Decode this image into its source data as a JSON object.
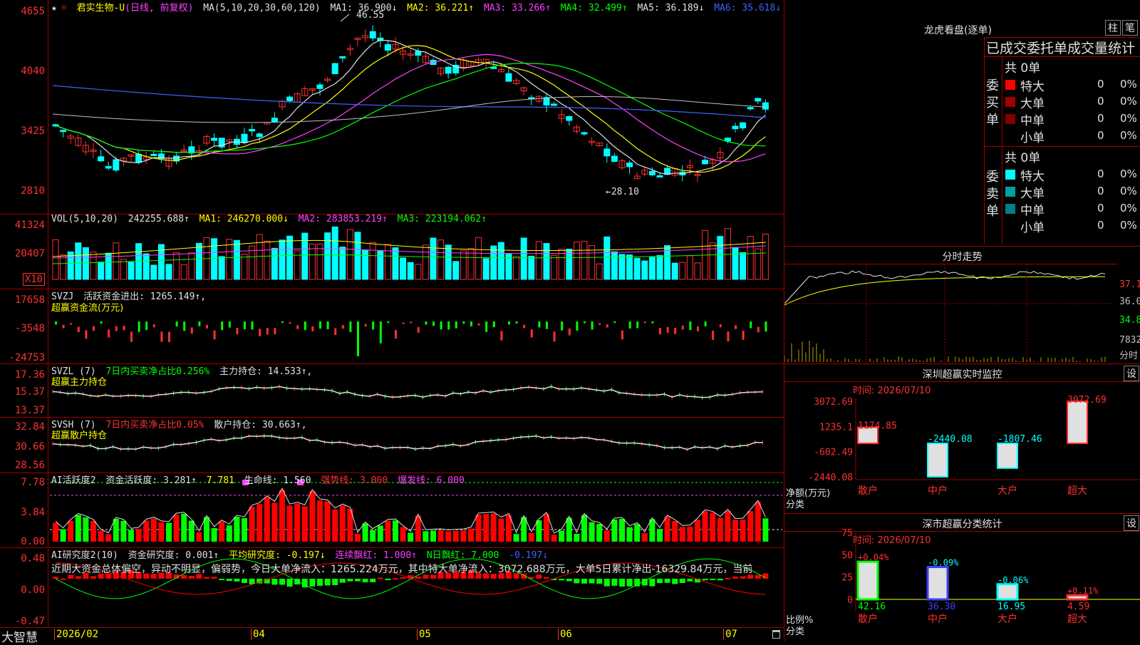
{
  "header": {
    "star": "★",
    "gear": "☼",
    "stock_name": "君实生物-U",
    "period": "(日线, 前复权)",
    "ma_params": "MA(5,10,20,30,60,120)",
    "ma1": "MA1: 36.900↓",
    "ma2": "MA2: 36.221↑",
    "ma3": "MA3: 33.266↑",
    "ma4": "MA4: 32.499↑",
    "ma5": "MA5: 36.189↓",
    "ma6": "MA6: 35.618↓",
    "high_label": "46.55",
    "low_label": "←28.10"
  },
  "price_axis": [
    "4655",
    "4040",
    "3425",
    "2810"
  ],
  "vol": {
    "header": "VOL(5,10,20)",
    "value": "242255.688↑",
    "ma1": "MA1: 246270.000↓",
    "ma2": "MA2: 283853.219↑",
    "ma3": "MA3: 223194.062↑",
    "axis": [
      "41324",
      "20407"
    ],
    "unit": "X10"
  },
  "svzj": {
    "header": "SVZJ",
    "label": "活跃资金进出: 1265.149↑,",
    "sub": "超赢资金流(万元)",
    "axis": [
      "17658",
      "-3548",
      "-24753"
    ]
  },
  "svzl": {
    "header": "SVZL (7)",
    "label1": "7日内买卖净占比0.256%",
    "label2": "主力持仓: 14.533↑,",
    "sub": "超赢主力持仓",
    "axis": [
      "17.36",
      "15.37",
      "13.37"
    ]
  },
  "svsh": {
    "header": "SVSH (7)",
    "label1": "7日内买卖净占比0.05%",
    "label2": "散户持仓: 30.663↑,",
    "sub": "超赢散户持仓",
    "axis": [
      "32.84",
      "30.66",
      "28.56"
    ]
  },
  "ai1": {
    "header": "AI活跃度2",
    "label1": "资金活跃度: 3.281↑",
    "label2": "7.781",
    "label3": "生命线: 1.560",
    "label4": "强势线: 3.000",
    "label5": "爆发线: 6.000",
    "axis": [
      "7.78",
      "3.84",
      "0.00"
    ]
  },
  "ai2": {
    "header": "AI研究度2(10)",
    "label1": "资金研究度: 0.001↑",
    "label2": "平均研究度: -0.197↓",
    "label3": "连续飘红: 1.000↑",
    "label4": "N日飘红: 7.000",
    "label5": "-0.197↓",
    "text": "近期大资金总体偏空，异动不明显，偏弱势，今日大单净流入：1265.224万元，其中特大单净流入：3072.688万元，大单5日累计净出-16329.84万元，当前",
    "axis": [
      "0.48",
      "0.00",
      "-0.47"
    ]
  },
  "bottom": {
    "brand": "大智慧",
    "dates": [
      "2026/02",
      "04",
      "05",
      "06",
      "07"
    ]
  },
  "longhu": {
    "title": "龙虎看盘(逐单)",
    "btn1": "柱",
    "btn2": "笔",
    "subtitle": "已成交委托单成交量统计",
    "buy_label": "委买单",
    "sell_label": "委卖单",
    "buy_total": "共 0单",
    "sell_total": "共 0单",
    "rows": [
      {
        "name": "特大",
        "count": "0",
        "pct": "0%"
      },
      {
        "name": "大单",
        "count": "0",
        "pct": "0%"
      },
      {
        "name": "中单",
        "count": "0",
        "pct": "0%"
      },
      {
        "name": "小单",
        "count": "0",
        "pct": "0%"
      }
    ],
    "buy_colors": [
      "#ff0000",
      "#a00000",
      "#800000",
      "#000000"
    ],
    "sell_colors": [
      "#00ffff",
      "#00a0a0",
      "#008080",
      "#000000"
    ]
  },
  "intraday": {
    "title": "分时走势",
    "axis": [
      "37.15",
      "36.00",
      "34.85",
      "7832",
      "分时"
    ]
  },
  "sz_monitor": {
    "title": "深圳超赢实时监控",
    "btn": "设",
    "time": "时间: 2026/07/10",
    "axis": [
      "3072.69",
      "1235.1",
      "-602.49",
      "-2440.08"
    ],
    "ylabel": "净额(万元)",
    "xlabel": "分类",
    "categories": [
      "散户",
      "中户",
      "大户",
      "超大"
    ],
    "value_labels": [
      "1174.85",
      "-2440.08",
      "-1807.46",
      "3072.69"
    ]
  },
  "sz_class": {
    "title": "深市超赢分类统计",
    "btn": "设",
    "time": "时间: 2026/07/10",
    "axis": [
      "75",
      "50",
      "25",
      "0"
    ],
    "ylabel": "比例%",
    "xlabel": "分类",
    "categories": [
      "散户",
      "中户",
      "大户",
      "超大"
    ],
    "top_labels": [
      "+0.04%",
      "-0.09%",
      "-0.06%",
      "+0.11%"
    ],
    "bottom_labels": [
      "42.16",
      "36.30",
      "16.95",
      "4.59"
    ]
  },
  "chart_data": [
    {
      "type": "bar",
      "title": "深圳超赢实时监控",
      "categories": [
        "散户",
        "中户",
        "大户",
        "超大"
      ],
      "values": [
        1174.85,
        -2440.08,
        -1807.46,
        3072.69
      ],
      "ylabel": "净额(万元)",
      "ylim": [
        -2440.08,
        3072.69
      ]
    },
    {
      "type": "bar",
      "title": "深市超赢分类统计",
      "categories": [
        "散户",
        "中户",
        "大户",
        "超大"
      ],
      "values": [
        42.16,
        36.3,
        16.95,
        4.59
      ],
      "ylabel": "比例%",
      "ylim": [
        0,
        75
      ]
    }
  ]
}
